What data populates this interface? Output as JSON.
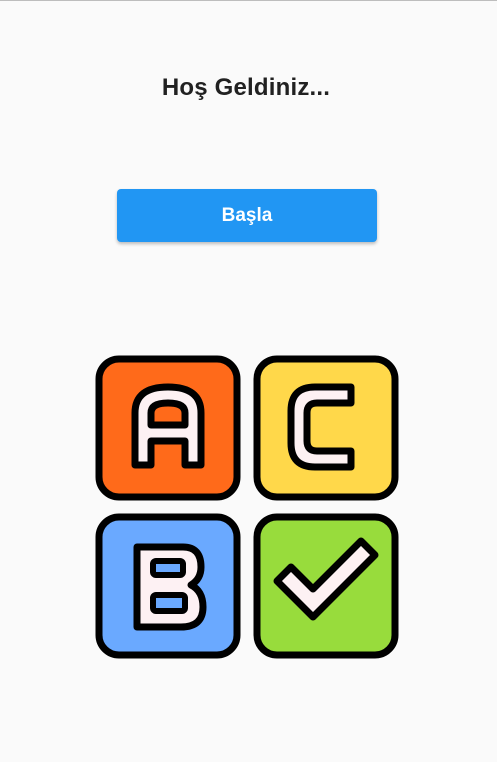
{
  "app": {
    "title": "Hoş Geldiniz...",
    "start_button_label": "Başla"
  },
  "logo": {
    "tiles": [
      {
        "letter": "A",
        "color": "#ff6a1a"
      },
      {
        "letter": "C",
        "color": "#ffd84a"
      },
      {
        "letter": "B",
        "color": "#6aa9ff"
      },
      {
        "letter": "check",
        "color": "#98dc3c"
      }
    ],
    "outline_color": "#000000",
    "glyph_fill": "#fdf1f3"
  }
}
